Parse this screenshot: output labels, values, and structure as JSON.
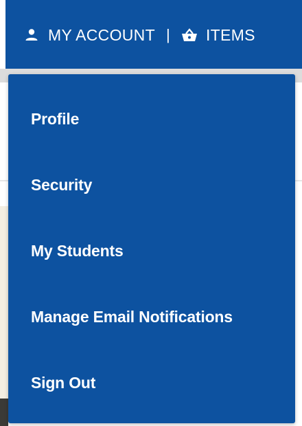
{
  "colors": {
    "brand": "#0d52a0",
    "text": "#ffffff"
  },
  "header": {
    "account_label": "MY ACCOUNT",
    "separator": "|",
    "items_label": "ITEMS",
    "account_icon": "user-icon",
    "items_icon": "basket-icon"
  },
  "dropdown": {
    "items": [
      {
        "label": "Profile"
      },
      {
        "label": "Security"
      },
      {
        "label": "My Students"
      },
      {
        "label": "Manage Email Notifications"
      },
      {
        "label": "Sign Out"
      }
    ]
  }
}
